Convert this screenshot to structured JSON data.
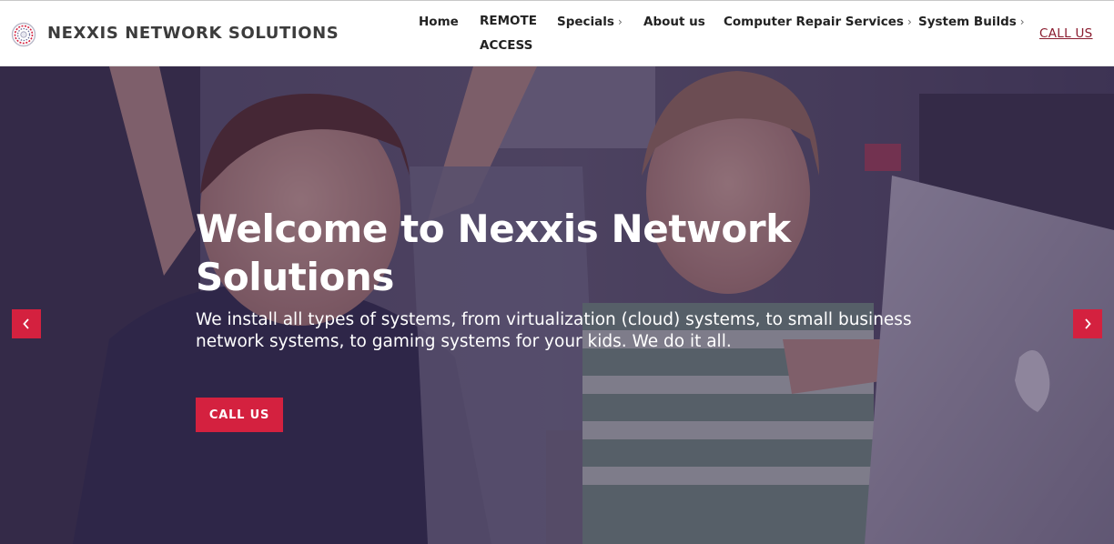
{
  "brand": {
    "name": "NEXXIS NETWORK SOLUTIONS",
    "logo_icon": "circular-logo-icon"
  },
  "nav": {
    "home": "Home",
    "remote_line1": "REMOTE",
    "remote_line2": "ACCESS",
    "specials": "Specials",
    "about": "About us",
    "repair": "Computer Repair Services",
    "builds": "System Builds",
    "call": "CALL US",
    "chevron": "›"
  },
  "hero": {
    "title": "Welcome to Nexxis Network Solutions",
    "subtitle": "We install all types of systems, from virtualization (cloud) systems, to small business network systems, to gaming systems for your kids. We do it all.",
    "button": "CALL US",
    "prev_icon": "chevron-left-icon",
    "next_icon": "chevron-right-icon"
  },
  "colors": {
    "accent": "#d4213f",
    "call_link": "#8a1c2f",
    "overlay": "#2d2048",
    "brand_text": "#3c3c3c"
  }
}
